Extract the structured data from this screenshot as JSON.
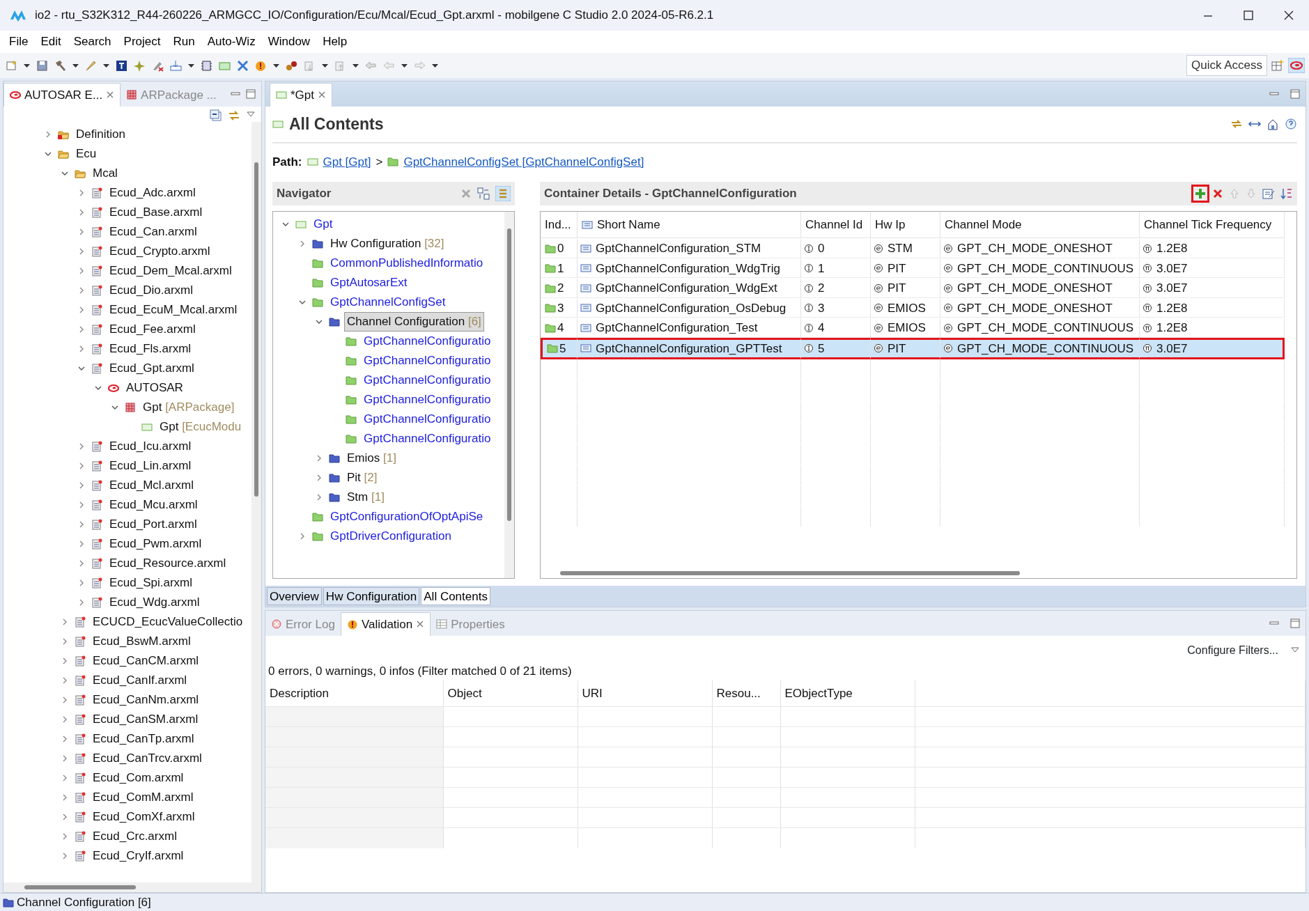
{
  "window": {
    "title": "io2 - rtu_S32K312_R44-260226_ARMGCC_IO/Configuration/Ecu/Mcal/Ecud_Gpt.arxml - mobilgene C Studio 2.0 2024-05-R6.2.1"
  },
  "menu": [
    "File",
    "Edit",
    "Search",
    "Project",
    "Run",
    "Auto-Wiz",
    "Window",
    "Help"
  ],
  "quick_access": "Quick Access",
  "explorer": {
    "tabs": [
      {
        "label": "AUTOSAR E...",
        "kind": "autosar",
        "selected": true
      },
      {
        "label": "ARPackage ...",
        "kind": "package",
        "selected": false
      }
    ],
    "tree": [
      {
        "label": "Definition",
        "kind": "folder-red",
        "expanded": false
      },
      {
        "label": "Ecu",
        "kind": "folder-open",
        "expanded": true,
        "children": [
          {
            "label": "Mcal",
            "kind": "folder-open",
            "expanded": true,
            "children": [
              {
                "label": "Ecud_Adc.arxml",
                "kind": "file",
                "expanded": false
              },
              {
                "label": "Ecud_Base.arxml",
                "kind": "file",
                "expanded": false
              },
              {
                "label": "Ecud_Can.arxml",
                "kind": "file",
                "expanded": false
              },
              {
                "label": "Ecud_Crypto.arxml",
                "kind": "file",
                "expanded": false
              },
              {
                "label": "Ecud_Dem_Mcal.arxml",
                "kind": "file",
                "expanded": false
              },
              {
                "label": "Ecud_Dio.arxml",
                "kind": "file",
                "expanded": false
              },
              {
                "label": "Ecud_EcuM_Mcal.arxml",
                "kind": "file",
                "expanded": false
              },
              {
                "label": "Ecud_Fee.arxml",
                "kind": "file",
                "expanded": false
              },
              {
                "label": "Ecud_Fls.arxml",
                "kind": "file",
                "expanded": false
              },
              {
                "label": "Ecud_Gpt.arxml",
                "kind": "file",
                "expanded": true,
                "children": [
                  {
                    "label": "AUTOSAR",
                    "kind": "autosar",
                    "expanded": true,
                    "children": [
                      {
                        "label": "Gpt",
                        "suffix": "[ARPackage]",
                        "kind": "package",
                        "expanded": true,
                        "children": [
                          {
                            "label": "Gpt",
                            "suffix": "[EcucModu",
                            "kind": "module"
                          }
                        ]
                      }
                    ]
                  }
                ]
              },
              {
                "label": "Ecud_Icu.arxml",
                "kind": "file",
                "expanded": false
              },
              {
                "label": "Ecud_Lin.arxml",
                "kind": "file",
                "expanded": false
              },
              {
                "label": "Ecud_Mcl.arxml",
                "kind": "file",
                "expanded": false
              },
              {
                "label": "Ecud_Mcu.arxml",
                "kind": "file",
                "expanded": false
              },
              {
                "label": "Ecud_Port.arxml",
                "kind": "file",
                "expanded": false
              },
              {
                "label": "Ecud_Pwm.arxml",
                "kind": "file",
                "expanded": false
              },
              {
                "label": "Ecud_Resource.arxml",
                "kind": "file",
                "expanded": false
              },
              {
                "label": "Ecud_Spi.arxml",
                "kind": "file",
                "expanded": false
              },
              {
                "label": "Ecud_Wdg.arxml",
                "kind": "file",
                "expanded": false
              }
            ]
          },
          {
            "label": "ECUCD_EcucValueCollectio",
            "kind": "file",
            "expanded": false
          },
          {
            "label": "Ecud_BswM.arxml",
            "kind": "file",
            "expanded": false
          },
          {
            "label": "Ecud_CanCM.arxml",
            "kind": "file",
            "expanded": false
          },
          {
            "label": "Ecud_CanIf.arxml",
            "kind": "file",
            "expanded": false
          },
          {
            "label": "Ecud_CanNm.arxml",
            "kind": "file",
            "expanded": false
          },
          {
            "label": "Ecud_CanSM.arxml",
            "kind": "file",
            "expanded": false
          },
          {
            "label": "Ecud_CanTp.arxml",
            "kind": "file",
            "expanded": false
          },
          {
            "label": "Ecud_CanTrcv.arxml",
            "kind": "file",
            "expanded": false
          },
          {
            "label": "Ecud_Com.arxml",
            "kind": "file",
            "expanded": false
          },
          {
            "label": "Ecud_ComM.arxml",
            "kind": "file",
            "expanded": false
          },
          {
            "label": "Ecud_ComXf.arxml",
            "kind": "file",
            "expanded": false
          },
          {
            "label": "Ecud_Crc.arxml",
            "kind": "file",
            "expanded": false
          },
          {
            "label": "Ecud_CryIf.arxml",
            "kind": "file",
            "expanded": false
          }
        ]
      }
    ]
  },
  "editor": {
    "tab": "*Gpt",
    "title": "All Contents",
    "path": {
      "label": "Path:",
      "separator": ">",
      "items": [
        {
          "text": "Gpt [Gpt]",
          "kind": "module"
        },
        {
          "text": "GptChannelConfigSet [GptChannelConfigSet]",
          "kind": "folder-green"
        }
      ]
    },
    "navigator": {
      "title": "Navigator",
      "tree": [
        {
          "label": "Gpt",
          "kind": "module",
          "expanded": true,
          "selected": false,
          "children": [
            {
              "label": "Hw Configuration",
              "suffix": "[32]",
              "kind": "folder-blue",
              "expanded": false,
              "selected": false
            },
            {
              "label": "CommonPublishedInformatio",
              "kind": "folder-green",
              "selected": false
            },
            {
              "label": "GptAutosarExt",
              "kind": "folder-green",
              "selected": false
            },
            {
              "label": "GptChannelConfigSet",
              "kind": "folder-green",
              "expanded": true,
              "selected": false,
              "children": [
                {
                  "label": "Channel Configuration",
                  "suffix": "[6]",
                  "kind": "folder-blue",
                  "expanded": true,
                  "selected": true,
                  "children": [
                    {
                      "label": "GptChannelConfiguratio",
                      "kind": "folder-green",
                      "selected": false
                    },
                    {
                      "label": "GptChannelConfiguratio",
                      "kind": "folder-green",
                      "selected": false
                    },
                    {
                      "label": "GptChannelConfiguratio",
                      "kind": "folder-green",
                      "selected": false
                    },
                    {
                      "label": "GptChannelConfiguratio",
                      "kind": "folder-green",
                      "selected": false
                    },
                    {
                      "label": "GptChannelConfiguratio",
                      "kind": "folder-green",
                      "selected": false
                    },
                    {
                      "label": "GptChannelConfiguratio",
                      "kind": "folder-green",
                      "selected": false
                    }
                  ]
                },
                {
                  "label": "Emios",
                  "suffix": "[1]",
                  "kind": "folder-blue",
                  "expanded": false,
                  "selected": false
                },
                {
                  "label": "Pit",
                  "suffix": "[2]",
                  "kind": "folder-blue",
                  "expanded": false,
                  "selected": false
                },
                {
                  "label": "Stm",
                  "suffix": "[1]",
                  "kind": "folder-blue",
                  "expanded": false,
                  "selected": false
                }
              ]
            },
            {
              "label": "GptConfigurationOfOptApiSe",
              "kind": "folder-green",
              "selected": false
            },
            {
              "label": "GptDriverConfiguration",
              "kind": "folder-green",
              "expanded": false,
              "selected": false
            }
          ]
        }
      ]
    },
    "container_details": {
      "title": "Container Details - GptChannelConfiguration",
      "add_highlighted": true,
      "columns": [
        "Ind...",
        "Short Name",
        "Channel Id",
        "Hw Ip",
        "Channel Mode",
        "Channel Tick Frequency"
      ],
      "rows": [
        {
          "index": "0",
          "short_name": "GptChannelConfiguration_STM",
          "channel_id": "0",
          "hw_ip": "STM",
          "channel_mode": "GPT_CH_MODE_ONESHOT",
          "tick_frequency": "1.2E8",
          "selected": false,
          "highlighted": false
        },
        {
          "index": "1",
          "short_name": "GptChannelConfiguration_WdgTrig",
          "channel_id": "1",
          "hw_ip": "PIT",
          "channel_mode": "GPT_CH_MODE_CONTINUOUS",
          "tick_frequency": "3.0E7",
          "selected": false,
          "highlighted": false
        },
        {
          "index": "2",
          "short_name": "GptChannelConfiguration_WdgExt",
          "channel_id": "2",
          "hw_ip": "PIT",
          "channel_mode": "GPT_CH_MODE_ONESHOT",
          "tick_frequency": "3.0E7",
          "selected": false,
          "highlighted": false
        },
        {
          "index": "3",
          "short_name": "GptChannelConfiguration_OsDebug",
          "channel_id": "3",
          "hw_ip": "EMIOS",
          "channel_mode": "GPT_CH_MODE_ONESHOT",
          "tick_frequency": "1.2E8",
          "selected": false,
          "highlighted": false
        },
        {
          "index": "4",
          "short_name": "GptChannelConfiguration_Test",
          "channel_id": "4",
          "hw_ip": "EMIOS",
          "channel_mode": "GPT_CH_MODE_CONTINUOUS",
          "tick_frequency": "1.2E8",
          "selected": false,
          "highlighted": false
        },
        {
          "index": "5",
          "short_name": "GptChannelConfiguration_GPTTest",
          "channel_id": "5",
          "hw_ip": "PIT",
          "channel_mode": "GPT_CH_MODE_CONTINUOUS",
          "tick_frequency": "3.0E7",
          "selected": true,
          "highlighted": true
        }
      ]
    },
    "page_tabs": [
      {
        "label": "Overview",
        "selected": false
      },
      {
        "label": "Hw Configuration",
        "selected": false
      },
      {
        "label": "All Contents",
        "selected": true
      }
    ]
  },
  "views": {
    "tabs": [
      {
        "label": "Error Log",
        "kind": "error",
        "selected": false
      },
      {
        "label": "Validation",
        "kind": "warning",
        "selected": true
      },
      {
        "label": "Properties",
        "kind": "properties",
        "selected": false
      }
    ],
    "configure_filters": "Configure Filters...",
    "summary": "0 errors, 0 warnings, 0 infos (Filter matched 0 of 21 items)",
    "columns": [
      "Description",
      "Object",
      "URI",
      "Resou...",
      "EObjectType"
    ]
  },
  "status_bar": "Channel Configuration [6]"
}
